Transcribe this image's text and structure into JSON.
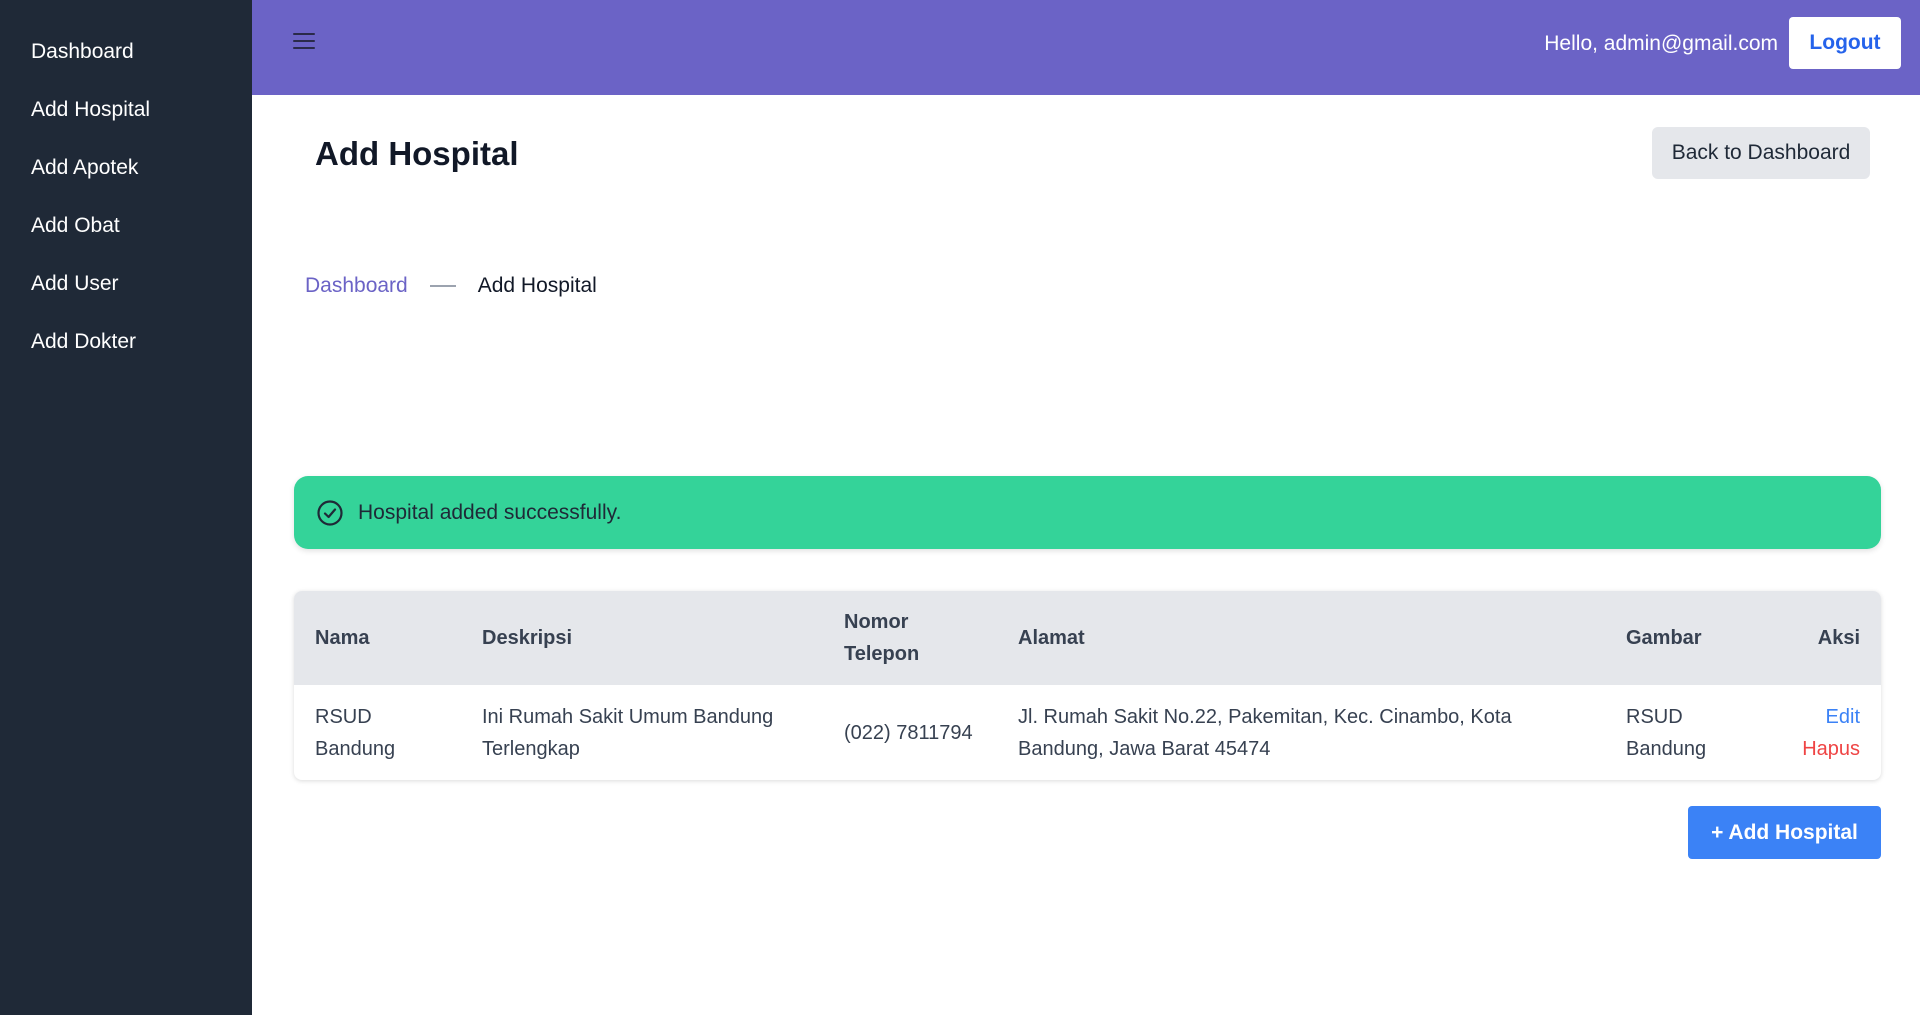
{
  "sidebar": {
    "items": [
      {
        "label": "Dashboard"
      },
      {
        "label": "Add Hospital"
      },
      {
        "label": "Add Apotek"
      },
      {
        "label": "Add Obat"
      },
      {
        "label": "Add User"
      },
      {
        "label": "Add Dokter"
      }
    ]
  },
  "topbar": {
    "menu_icon": "hamburger-menu-icon",
    "greeting": "Hello, admin@gmail.com",
    "logout_label": "Logout",
    "background_color": "#6b63c6"
  },
  "page": {
    "title": "Add Hospital",
    "back_label": "Back to Dashboard"
  },
  "breadcrumb": {
    "link": "Dashboard",
    "current": "Add Hospital"
  },
  "alert": {
    "icon": "check-circle-icon",
    "message": "Hospital added successfully.",
    "color": "#34d399"
  },
  "table": {
    "headers": {
      "nama": "Nama",
      "deskripsi": "Deskripsi",
      "nomor_telepon": "Nomor Telepon",
      "alamat": "Alamat",
      "gambar": "Gambar",
      "aksi": "Aksi"
    },
    "rows": [
      {
        "nama": "RSUD Bandung",
        "deskripsi": "Ini Rumah Sakit Umum Bandung Terlengkap",
        "nomor_telepon": "(022) 7811794",
        "alamat": "Jl. Rumah Sakit No.22, Pakemitan, Kec. Cinambo, Kota Bandung, Jawa Barat 45474",
        "gambar_alt": "RSUD Bandung",
        "edit_label": "Edit",
        "delete_label": "Hapus"
      }
    ]
  },
  "add_button_label": "+ Add Hospital"
}
